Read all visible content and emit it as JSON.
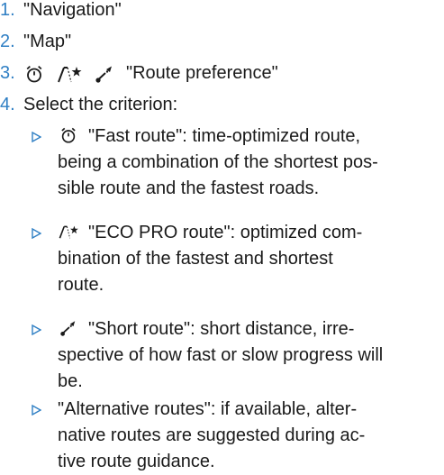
{
  "steps": [
    {
      "number": "1.",
      "text": "\"Navigation\""
    },
    {
      "number": "2.",
      "text": "\"Map\""
    },
    {
      "number": "3.",
      "icons": [
        "stopwatch-icon",
        "eco-pro-route-icon",
        "short-route-icon"
      ],
      "text": "\"Route preference\""
    },
    {
      "number": "4.",
      "text": "Select the criterion:"
    }
  ],
  "options": [
    {
      "icon": "stopwatch-icon",
      "lines": [
        "\"Fast route\": time-optimized route,",
        "being a combination of the shortest pos-",
        "sible route and the fastest roads."
      ]
    },
    {
      "icon": "eco-pro-route-icon",
      "lines": [
        "\"ECO PRO route\": optimized com-",
        "bination of the fastest and shortest",
        "route."
      ]
    },
    {
      "icon": "short-route-icon",
      "lines": [
        "\"Short route\": short distance, irre-",
        "spective of how fast or slow progress will",
        "be."
      ]
    },
    {
      "icon": "",
      "lines": [
        "\"Alternative routes\": if available, alter-",
        "native routes are suggested during ac-",
        "tive route guidance."
      ]
    }
  ],
  "colors": {
    "accent": "#2f7fc4",
    "text": "#1a1a1a"
  }
}
